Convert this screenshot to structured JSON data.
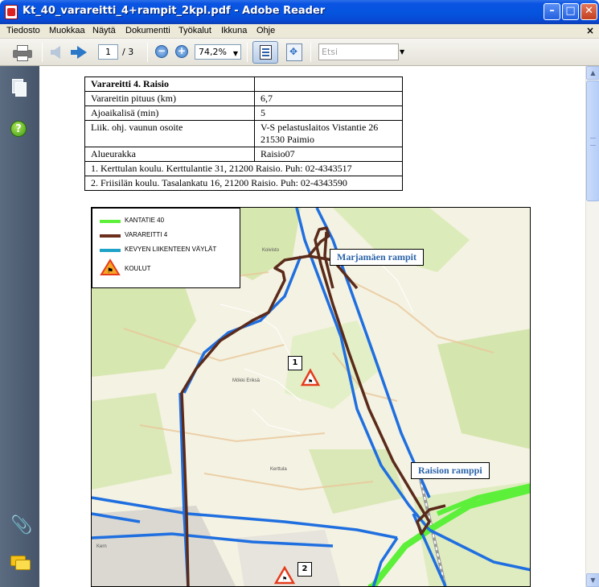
{
  "window": {
    "title": "Kt_40_varareitti_4+rampit_2kpl.pdf - Adobe Reader",
    "minimize": "–",
    "maximize": "□",
    "close": "✕"
  },
  "menu": {
    "items": [
      "Tiedosto",
      "Muokkaa",
      "Näytä",
      "Dokumentti",
      "Työkalut",
      "Ikkuna",
      "Ohje"
    ],
    "doc_close": "×"
  },
  "toolbar": {
    "page_current": "1",
    "page_total": "/ 3",
    "zoom_out": "−",
    "zoom_in": "+",
    "zoom": "74,2%",
    "search_placeholder": "Etsi"
  },
  "icons": {
    "print": "printer-icon",
    "prev": "arrow-left-icon",
    "next": "arrow-right-icon",
    "fit_width": "fit-width-icon",
    "fit_page": "fit-page-icon",
    "pages": "pages-icon",
    "help": "help-icon",
    "attachment": "paperclip-icon",
    "comments": "comments-icon",
    "help_glyph": "?",
    "attach_glyph": "📎",
    "dropdown_glyph": "▼",
    "scroll_up_glyph": "▲",
    "scroll_down_glyph": "▼"
  },
  "document": {
    "table": {
      "title": "Varareitti 4. Raisio",
      "rows": [
        {
          "key": "Varareitin pituus (km)",
          "value": "6,7"
        },
        {
          "key": "Ajoaikalisä (min)",
          "value": "5"
        },
        {
          "key": "Liik. ohj. vaunun osoite",
          "value": "V-S pelastuslaitos Vistantie 26",
          "value2": "21530 Paimio"
        },
        {
          "key": "Alueurakka",
          "value": "Raisio07"
        }
      ],
      "schools": [
        "1. Kerttulan koulu. Kerttulantie 31, 21200 Raisio. Puh: 02-4343517",
        "2. Friisilän koulu. Tasalankatu 16, 21200 Raisio. Puh: 02-4343590"
      ]
    },
    "map": {
      "legend": [
        {
          "label": "KANTATIE 40",
          "color": "#5cf03a"
        },
        {
          "label": "VARAREITTI 4",
          "color": "#6b2e1c"
        },
        {
          "label": "KEVYEN LIIKENTEEN VÄYLÄT",
          "color": "#1ea2c8"
        },
        {
          "label": "KOULUT",
          "color": "#e53b1c"
        }
      ],
      "labels": {
        "marjamaki": "Marjamäen rampit",
        "raisio": "Raision ramppi"
      },
      "school_numbers": [
        "1",
        "2"
      ],
      "place_names": {
        "koivisto": "Koivisto",
        "kerttula": "Kerttula",
        "mokki": "Mökki Eriksä",
        "kerrokset": "Kern"
      },
      "colors": {
        "road_blue": "#1f6fe0",
        "route_brown": "#5a2a1a",
        "highway_green": "#5cf03a",
        "forest": "#cfe6a8",
        "field": "#f3f1df",
        "urban": "#d8d6d0"
      }
    }
  }
}
